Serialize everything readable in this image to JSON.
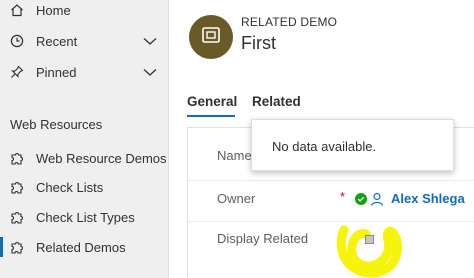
{
  "sidebar": {
    "home_label": "Home",
    "recent_label": "Recent",
    "pinned_label": "Pinned",
    "section_title": "Web Resources",
    "items": [
      {
        "label": "Web Resource Demos"
      },
      {
        "label": "Check Lists"
      },
      {
        "label": "Check List Types"
      },
      {
        "label": "Related Demos"
      }
    ]
  },
  "header": {
    "entity_label": "RELATED DEMO",
    "record_title": "First"
  },
  "tabs": [
    {
      "label": "General"
    },
    {
      "label": "Related"
    }
  ],
  "form": {
    "name_label": "Name",
    "owner_label": "Owner",
    "owner_required": "*",
    "owner_value": "Alex Shlega",
    "display_related_label": "Display Related"
  },
  "popup": {
    "message": "No data available."
  },
  "colors": {
    "accent": "#0f6cbd",
    "avatar": "#6a5a28",
    "highlight": "#f5f200",
    "presence": "#13a10e"
  },
  "icons": {
    "home": "home-icon",
    "recent": "clock-icon",
    "pinned": "pin-icon",
    "entity": "puzzle-icon",
    "owner": "person-icon"
  }
}
